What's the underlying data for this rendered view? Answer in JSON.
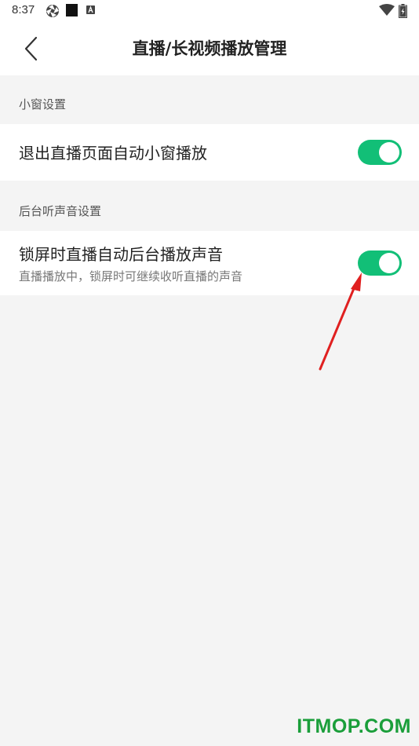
{
  "status_bar": {
    "time": "8:37",
    "icons": [
      "aperture-icon",
      "square-icon",
      "a-icon",
      "wifi-icon",
      "battery-icon"
    ]
  },
  "header": {
    "title": "直播/长视频播放管理",
    "back_icon": "chevron-left-icon"
  },
  "sections": [
    {
      "label": "小窗设置",
      "items": [
        {
          "title": "退出直播页面自动小窗播放",
          "toggle_on": true
        }
      ]
    },
    {
      "label": "后台听声音设置",
      "items": [
        {
          "title": "锁屏时直播自动后台播放声音",
          "description": "直播播放中，锁屏时可继续收听直播的声音",
          "toggle_on": true
        }
      ]
    }
  ],
  "colors": {
    "toggle_on": "#12bf77",
    "annotation_arrow": "#e02020",
    "background": "#f4f4f4"
  },
  "watermark": "ITMOP.COM"
}
